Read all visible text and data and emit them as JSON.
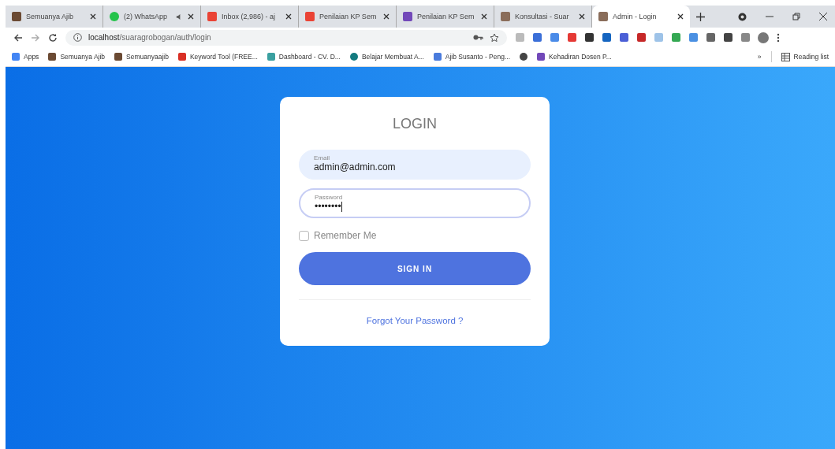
{
  "browser": {
    "tabs": [
      {
        "title": "Semuanya Ajib",
        "kind": "photo",
        "audio": false,
        "selected": false
      },
      {
        "title": "(2) WhatsApp",
        "kind": "whatsapp",
        "audio": true,
        "selected": false
      },
      {
        "title": "Inbox (2,986) - aj",
        "kind": "gmail",
        "audio": false,
        "selected": false
      },
      {
        "title": "Penilaian KP Sem",
        "kind": "gmail",
        "audio": false,
        "selected": false
      },
      {
        "title": "Penilaian KP Sem",
        "kind": "forms",
        "audio": false,
        "selected": false
      },
      {
        "title": "Konsultasi - Suar",
        "kind": "people",
        "audio": false,
        "selected": false
      },
      {
        "title": "Admin - Login",
        "kind": "people",
        "audio": false,
        "selected": true
      }
    ],
    "address": {
      "host": "localhost",
      "path": "/suaragrobogan/auth/login"
    },
    "bookmarks": [
      {
        "label": "Apps",
        "kind": "apps"
      },
      {
        "label": "Semuanya Ajib",
        "kind": "photo"
      },
      {
        "label": "Semuanyaajib",
        "kind": "photo"
      },
      {
        "label": "Keyword Tool (FREE...",
        "kind": "flame"
      },
      {
        "label": "Dashboard - CV. D...",
        "kind": "dash"
      },
      {
        "label": "Belajar Membuat A...",
        "kind": "circle"
      },
      {
        "label": "Ajib Susanto - Peng...",
        "kind": "cap"
      },
      {
        "kind": "globe"
      },
      {
        "label": "Kehadiran Dosen P...",
        "kind": "forms"
      }
    ],
    "overflow": "»",
    "reading_list": "Reading list"
  },
  "login": {
    "title": "LOGIN",
    "email": {
      "label": "Email",
      "value": "admin@admin.com"
    },
    "password": {
      "label": "Password",
      "value": "••••••••",
      "focused": true
    },
    "remember": {
      "label": "Remember Me",
      "checked": false
    },
    "submit": "SIGN IN",
    "forgot": "Forgot Your Password ?"
  }
}
